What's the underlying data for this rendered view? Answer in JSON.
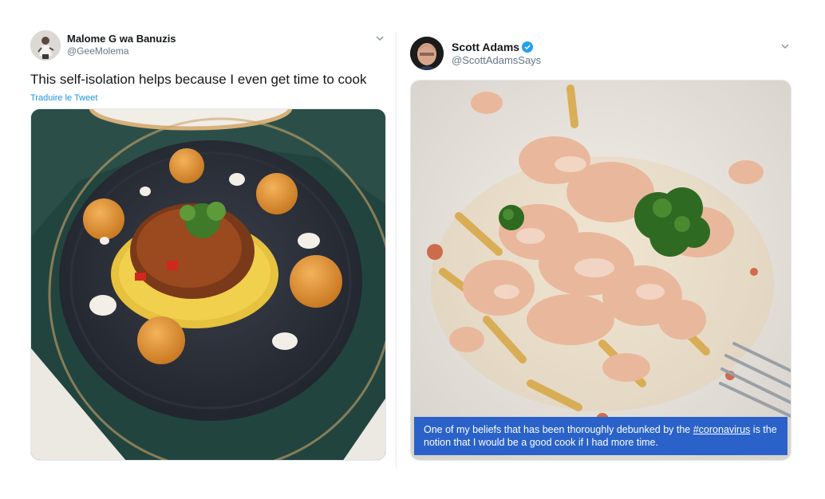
{
  "tweets": [
    {
      "name": "Malome G wa Banuzis",
      "handle": "@GeeMolema",
      "text": "This self-isolation helps because I even get time to cook",
      "translate": "Traduire le Tweet"
    },
    {
      "name": "Scott Adams",
      "handle": "@ScottAdamsSays",
      "verified": true,
      "caption_before": "One of my beliefs that has been thoroughly debunked by the ",
      "caption_hashtag": "#coronavirus",
      "caption_after": " is the notion that I would be a good cook if I had more time."
    }
  ],
  "colors": {
    "link": "#1b95e0",
    "verified": "#1da1f2",
    "caption_bg": "#2a62c9",
    "handle": "#657786"
  },
  "icons": [
    "chevron-down-icon",
    "verified-badge-icon"
  ]
}
